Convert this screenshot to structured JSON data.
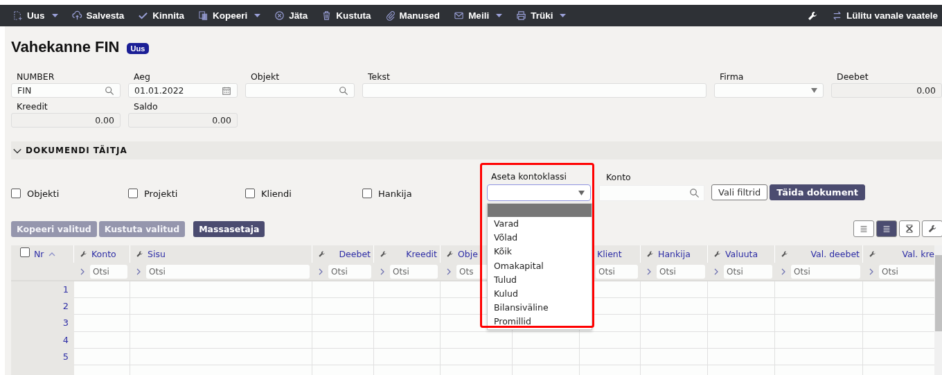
{
  "toolbar": {
    "left": [
      {
        "label": "Uus",
        "caret": true
      },
      {
        "label": "Salvesta",
        "caret": false
      },
      {
        "label": "Kinnita",
        "caret": false
      },
      {
        "label": "Kopeeri",
        "caret": true
      },
      {
        "label": "Jäta",
        "caret": false
      },
      {
        "label": "Kustuta",
        "caret": false
      },
      {
        "label": "Manused",
        "caret": false
      },
      {
        "label": "Meili",
        "caret": true
      },
      {
        "label": "Trüki",
        "caret": true
      }
    ],
    "right": [
      {
        "label": "Lülitu vanale vaatele"
      }
    ]
  },
  "header": {
    "title": "Vahekanne FIN",
    "badge": "Uus"
  },
  "fields": [
    {
      "label": "NUMBER",
      "kind": "search",
      "value": "FIN"
    },
    {
      "label": "Aeg",
      "kind": "date",
      "value": "01.01.2022"
    },
    {
      "label": "Objekt",
      "kind": "search"
    },
    {
      "label": "Tekst",
      "kind": "text"
    },
    {
      "label": "Firma",
      "kind": "select"
    },
    {
      "label": "Deebet",
      "kind": "readonly",
      "value": "0.00"
    },
    {
      "label": "Kreedit",
      "kind": "readonly",
      "value": "0.00"
    },
    {
      "label": "Saldo",
      "kind": "readonly",
      "value": "0.00"
    }
  ],
  "section": {
    "title": "DOKUMENDI TÄITJA",
    "expanded": true
  },
  "filters": [
    {
      "label": "Objekti",
      "checked": false
    },
    {
      "label": "Projekti",
      "checked": false
    },
    {
      "label": "Kliendi",
      "checked": false
    },
    {
      "label": "Hankija",
      "checked": false
    }
  ],
  "kontoklass": {
    "label": "Aseta kontoklassi",
    "open": true,
    "options": [
      {
        "label": "Varad",
        "selected": false
      },
      {
        "label": "Võlad",
        "selected": false
      },
      {
        "label": "Kõik",
        "selected": false
      },
      {
        "label": "Omakapital",
        "selected": false
      },
      {
        "label": "Tulud",
        "selected": false
      },
      {
        "label": "Kulud",
        "selected": false
      },
      {
        "label": "Bilansiväline",
        "selected": false
      },
      {
        "label": "Promillid",
        "selected": false
      }
    ]
  },
  "konto": {
    "label": "Konto"
  },
  "fill_buttons": [
    {
      "label": "Vali filtrid",
      "kind": "outline"
    },
    {
      "label": "Täida dokument",
      "kind": "primary"
    }
  ],
  "actions": [
    {
      "label": "Kopeeri valitud",
      "disabled": true
    },
    {
      "label": "Kustuta valitud",
      "disabled": true
    },
    {
      "label": "Massasetaja",
      "disabled": false
    }
  ],
  "view_buttons": [
    {
      "selected": false
    },
    {
      "selected": true
    },
    {
      "selected": false
    },
    {
      "selected": false
    }
  ],
  "table": {
    "all_selected": false,
    "columns": [
      {
        "label": "Nr"
      },
      {
        "label": "Konto",
        "filter_placeholder": "Otsi"
      },
      {
        "label": "Sisu",
        "filter_placeholder": "Otsi"
      },
      {
        "label": "Deebet",
        "filter_placeholder": "Otsi"
      },
      {
        "label": "Kreedit",
        "filter_placeholder": "Otsi"
      },
      {
        "label": "Obje",
        "filter_placeholder": "Ots"
      },
      {},
      {
        "label": "Klient",
        "filter_placeholder": "Otsi"
      },
      {
        "label": "Hankija",
        "filter_placeholder": "Otsi"
      },
      {
        "label": "Valuuta",
        "filter_placeholder": "Otsi"
      },
      {
        "label": "Val. deebet",
        "filter_placeholder": "Otsi"
      },
      {
        "label": "Val. kre",
        "filter_placeholder": "Otsi"
      }
    ],
    "rows": [
      "1",
      "2",
      "3",
      "4",
      "5",
      ""
    ]
  }
}
